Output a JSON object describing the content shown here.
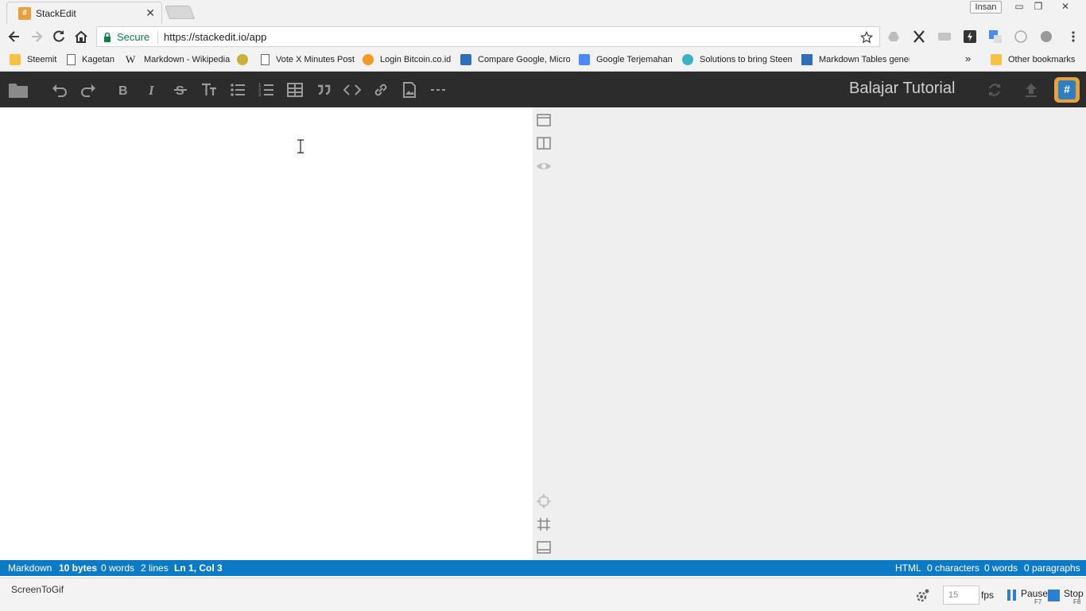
{
  "browser": {
    "tab_title": "StackEdit",
    "tab_close": "✕",
    "favicon_glyph": "#",
    "profile_name": "Insan",
    "window_controls": {
      "minimize": "▭",
      "restore": "❐",
      "close": "✕"
    },
    "secure_label": "Secure",
    "url": "https://stackedit.io/app",
    "bookmarks": [
      {
        "label": "Steemit",
        "icon": "folder-icon"
      },
      {
        "label": "Kagetan",
        "icon": "page-icon"
      },
      {
        "label": "Markdown - Wikipedia",
        "icon": "wikipedia-icon"
      },
      {
        "label": "",
        "icon": "globe-icon"
      },
      {
        "label": "Vote X Minutes Post",
        "icon": "page-icon"
      },
      {
        "label": "Login Bitcoin.co.id",
        "icon": "bitcoin-icon"
      },
      {
        "label": "Compare Google, Micros",
        "icon": "compare-icon"
      },
      {
        "label": "Google Terjemahan",
        "icon": "translate-icon"
      },
      {
        "label": "Solutions to bring Steem",
        "icon": "steem-icon"
      },
      {
        "label": "Markdown Tables gener",
        "icon": "table-icon"
      }
    ],
    "bookmarks_overflow": "»",
    "other_bookmarks": "Other bookmarks"
  },
  "stackedit": {
    "document_title": "Balajar Tutorial",
    "logo_glyph": "#",
    "toolbar_icons": [
      "folder-icon",
      "undo-icon",
      "redo-icon",
      "bold-icon",
      "italic-icon",
      "strikethrough-icon",
      "heading-icon",
      "unordered-list-icon",
      "ordered-list-icon",
      "table-icon",
      "quote-icon",
      "code-icon",
      "link-icon",
      "image-icon",
      "horizontal-rule-icon"
    ]
  },
  "statusbar": {
    "markdown": "Markdown",
    "bytes": "10 bytes",
    "words": "0 words",
    "lines": "2 lines",
    "position": "Ln 1, Col 3",
    "html": "HTML",
    "characters": "0 characters",
    "html_words": "0 words",
    "paragraphs": "0 paragraphs"
  },
  "screentogif": {
    "app_name": "ScreenToGif",
    "fps_value": "15",
    "fps_label": "fps",
    "pause_label": "Pause",
    "pause_key": "F7",
    "stop_label": "Stop",
    "stop_key": "F8"
  }
}
